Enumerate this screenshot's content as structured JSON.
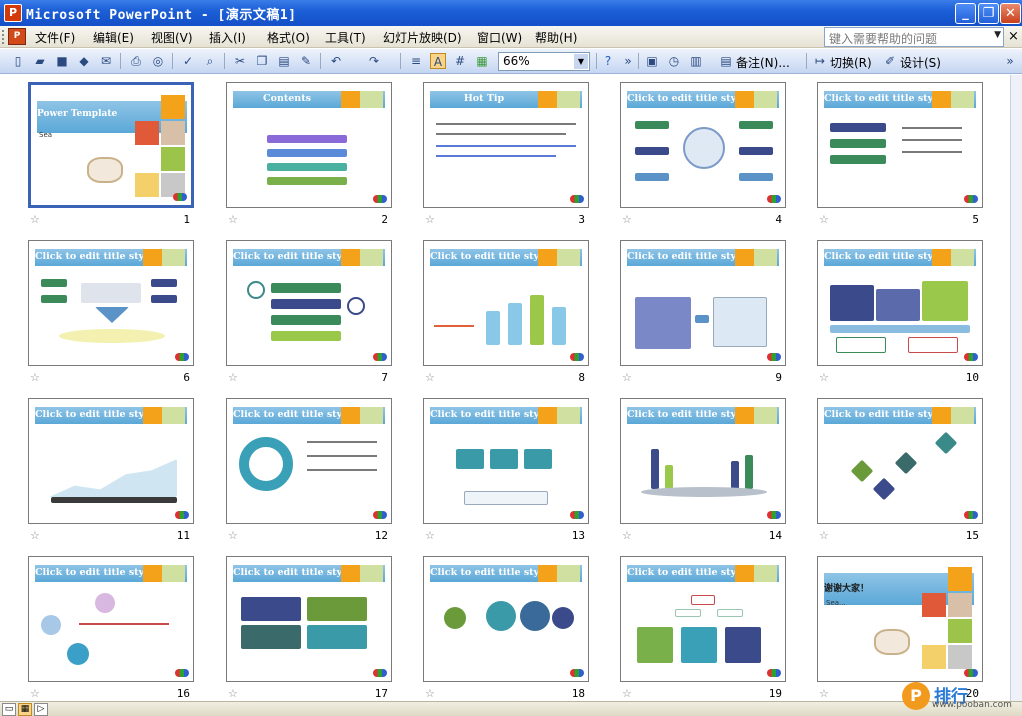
{
  "window": {
    "title": "Microsoft PowerPoint - [演示文稿1]",
    "app_icon": "P",
    "minimize_label": "_",
    "restore_label": "❐",
    "close_label": "✕"
  },
  "menu": {
    "items": [
      "文件(F)",
      "编辑(E)",
      "视图(V)",
      "插入(I)",
      "格式(O)",
      "工具(T)",
      "幻灯片放映(D)",
      "窗口(W)",
      "帮助(H)"
    ],
    "help_placeholder": "键入需要帮助的问题",
    "close_doc": "×"
  },
  "toolbar": {
    "zoom": "66%",
    "notes_label": "备注(N)...",
    "transition_label": "切换(R)",
    "design_label": "设计(S)"
  },
  "slides": [
    {
      "number": "1",
      "title": "Power Template",
      "subtitle": "Sea",
      "type": "cover"
    },
    {
      "number": "2",
      "title": "Contents",
      "type": "contents"
    },
    {
      "number": "3",
      "title": "Hot Tip",
      "type": "tip"
    },
    {
      "number": "4",
      "title": "Click to edit title style",
      "type": "hub"
    },
    {
      "number": "5",
      "title": "Click to edit title style",
      "type": "list"
    },
    {
      "number": "6",
      "title": "Click to edit title style",
      "type": "arrow"
    },
    {
      "number": "7",
      "title": "Click to edit title style",
      "type": "bars"
    },
    {
      "number": "8",
      "title": "Click to edit title style",
      "type": "cylinders"
    },
    {
      "number": "9",
      "title": "Click to edit title style",
      "type": "process"
    },
    {
      "number": "10",
      "title": "Click to edit title style",
      "type": "columns"
    },
    {
      "number": "11",
      "title": "Click to edit title style",
      "type": "area"
    },
    {
      "number": "12",
      "title": "Click to edit title style",
      "type": "donut"
    },
    {
      "number": "13",
      "title": "Click to edit title style",
      "type": "boxes"
    },
    {
      "number": "14",
      "title": "Click to edit title style",
      "type": "stage"
    },
    {
      "number": "15",
      "title": "Click to edit title style",
      "type": "history"
    },
    {
      "number": "16",
      "title": "Click to edit title style",
      "type": "spheres"
    },
    {
      "number": "17",
      "title": "Click to edit title style",
      "type": "quad"
    },
    {
      "number": "18",
      "title": "Click to edit title style",
      "type": "chain"
    },
    {
      "number": "19",
      "title": "Click to edit title style",
      "type": "org"
    },
    {
      "number": "20",
      "title": "谢谢大家！",
      "subtitle": "Sea...",
      "type": "end"
    }
  ],
  "watermark": {
    "text_cn": "排行",
    "url": "www.pooban.com"
  },
  "colors": {
    "header": "#5aa8d8",
    "selection": "#3a63b8",
    "titlebar": "#1c5fd6"
  }
}
